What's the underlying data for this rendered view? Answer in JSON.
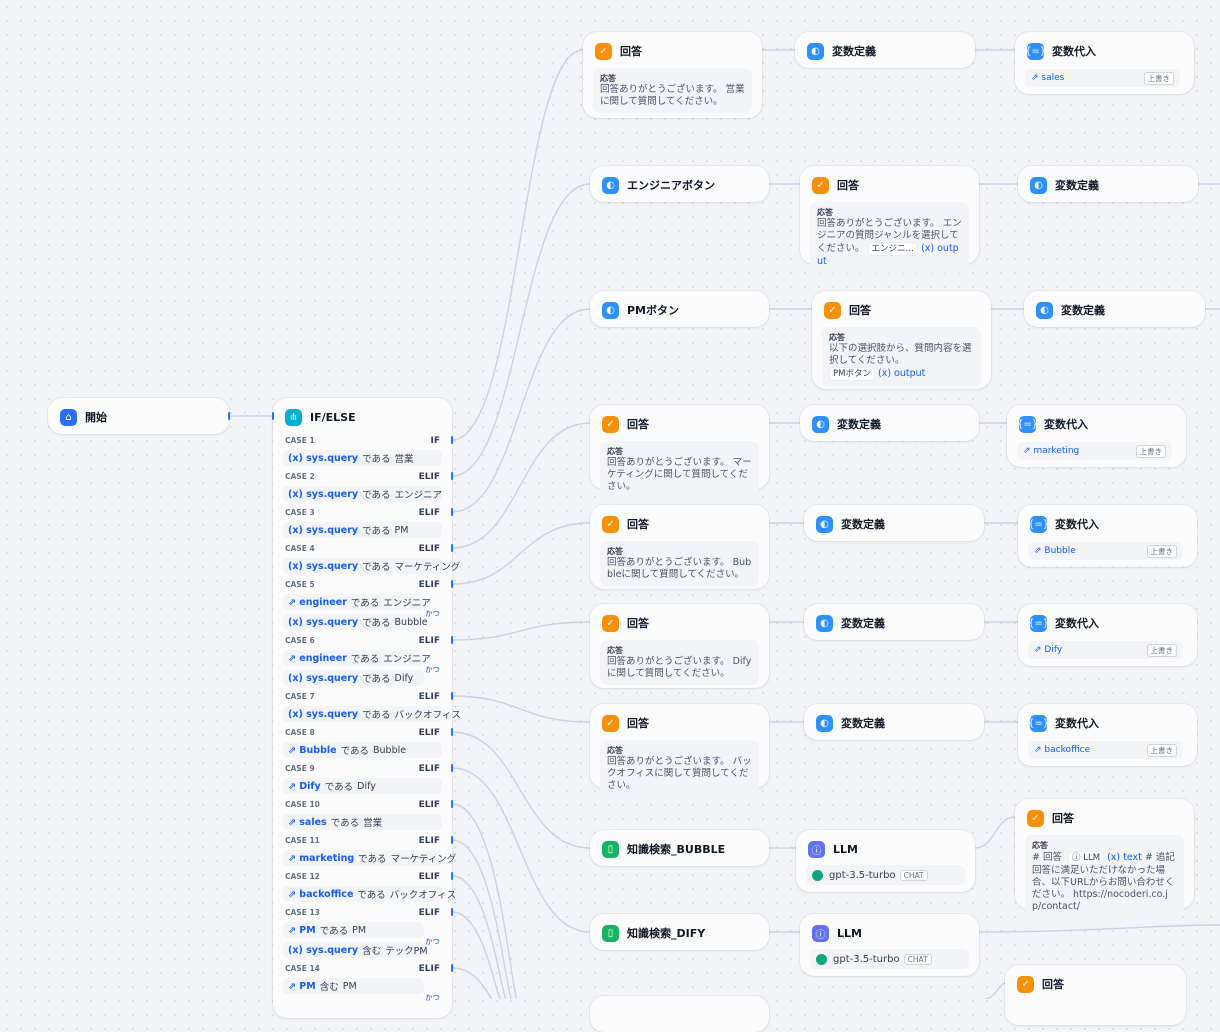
{
  "start": {
    "title": "開始"
  },
  "ifelse": {
    "title": "IF/ELSE",
    "cases": [
      {
        "label": "CASE 1",
        "kw": "IF",
        "conds": [
          {
            "var": "sys.query",
            "op": "である",
            "val": "営業"
          }
        ]
      },
      {
        "label": "CASE 2",
        "kw": "ELIF",
        "conds": [
          {
            "var": "sys.query",
            "op": "である",
            "val": "エンジニア"
          }
        ]
      },
      {
        "label": "CASE 3",
        "kw": "ELIF",
        "conds": [
          {
            "var": "sys.query",
            "op": "である",
            "val": "PM"
          }
        ]
      },
      {
        "label": "CASE 4",
        "kw": "ELIF",
        "conds": [
          {
            "var": "sys.query",
            "op": "である",
            "val": "マーケティング"
          }
        ]
      },
      {
        "label": "CASE 5",
        "kw": "ELIF",
        "and": "かつ",
        "conds": [
          {
            "var": "engineer",
            "op": "である",
            "val": "エンジニア"
          },
          {
            "var": "sys.query",
            "op": "である",
            "val": "Bubble"
          }
        ]
      },
      {
        "label": "CASE 6",
        "kw": "ELIF",
        "and": "かつ",
        "conds": [
          {
            "var": "engineer",
            "op": "である",
            "val": "エンジニア"
          },
          {
            "var": "sys.query",
            "op": "である",
            "val": "Dify"
          }
        ]
      },
      {
        "label": "CASE 7",
        "kw": "ELIF",
        "conds": [
          {
            "var": "sys.query",
            "op": "である",
            "val": "バックオフィス"
          }
        ]
      },
      {
        "label": "CASE 8",
        "kw": "ELIF",
        "conds": [
          {
            "var": "Bubble",
            "op": "である",
            "val": "Bubble"
          }
        ]
      },
      {
        "label": "CASE 9",
        "kw": "ELIF",
        "conds": [
          {
            "var": "Dify",
            "op": "である",
            "val": "Dify"
          }
        ]
      },
      {
        "label": "CASE 10",
        "kw": "ELIF",
        "conds": [
          {
            "var": "sales",
            "op": "である",
            "val": "営業"
          }
        ]
      },
      {
        "label": "CASE 11",
        "kw": "ELIF",
        "conds": [
          {
            "var": "marketing",
            "op": "である",
            "val": "マーケティング"
          }
        ]
      },
      {
        "label": "CASE 12",
        "kw": "ELIF",
        "conds": [
          {
            "var": "backoffice",
            "op": "である",
            "val": "バックオフィス"
          }
        ]
      },
      {
        "label": "CASE 13",
        "kw": "ELIF",
        "and": "かつ",
        "conds": [
          {
            "var": "PM",
            "op": "である",
            "val": "PM"
          },
          {
            "var": "sys.query",
            "op": "含む",
            "val": "テックPM"
          }
        ]
      },
      {
        "label": "CASE 14",
        "kw": "ELIF",
        "and": "かつ",
        "conds": [
          {
            "var": "PM",
            "op": "含む",
            "val": "PM"
          }
        ]
      }
    ]
  },
  "labels": {
    "answer": "回答",
    "response": "応答",
    "vardef": "変数定義",
    "assign": "変数代入",
    "overwrite": "上書き",
    "llm": "LLM",
    "chat": "CHAT",
    "output": "output",
    "text": "text"
  },
  "col1": {
    "sales_answer": "回答ありがとうございます。 営業に関して質問してください。",
    "eng_button": "エンジニアボタン",
    "pm_button": "PMボタン",
    "mkt_answer": "回答ありがとうございます。 マーケティングに関して質問してください。",
    "bubble_answer": "回答ありがとうございます。 Bubbleに関して質問してください。",
    "dify_answer": "回答ありがとうございます。 Difyに関して質問してください。",
    "bo_answer": "回答ありがとうございます。 バックオフィスに関して質問してください。",
    "kr_bubble": "知識検索_BUBBLE",
    "kr_dify": "知識検索_DIFY"
  },
  "col2": {
    "eng_answer": "回答ありがとうございます。 エンジニアの質問ジャンルを選択してください。",
    "eng_chip": "エンジニ…",
    "pm_answer": "以下の選択肢から、質問内容を選択してください。",
    "pm_chip": "PMボタン",
    "model": "gpt-3.5-turbo"
  },
  "col3": {
    "sales_var": "sales",
    "marketing_var": "marketing",
    "bubble_var": "Bubble",
    "dify_var": "Dify",
    "backoffice_var": "backoffice",
    "llm_answer_pre": "# 回答",
    "llm_answer_post": "# 追記 回答に満足いただけなかった場合、以下URLからお問い合わせください。 https://nocoderi.co.jp/contact/"
  }
}
